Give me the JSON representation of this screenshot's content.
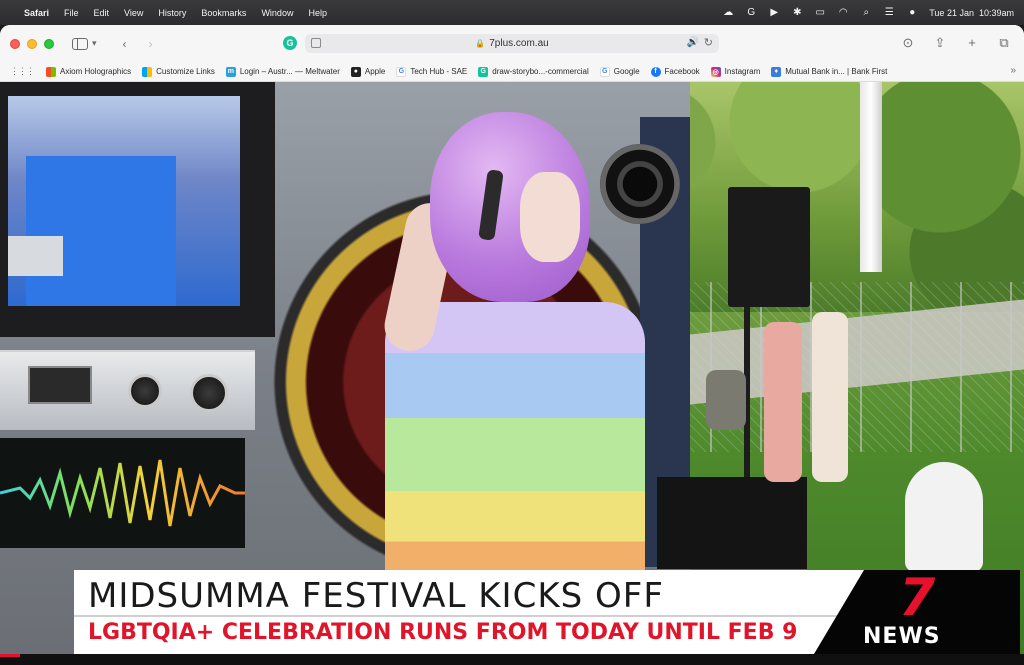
{
  "menubar": {
    "app_name": "Safari",
    "menus": [
      "File",
      "Edit",
      "View",
      "History",
      "Bookmarks",
      "Window",
      "Help"
    ],
    "date": "Tue 21 Jan",
    "time": "10:39am"
  },
  "browser": {
    "url": "7plus.com.au",
    "favorites": [
      {
        "label": "Axiom Holographics",
        "icon": "windows-grid-icon",
        "color": "#f25022"
      },
      {
        "label": "Customize Links",
        "icon": "windows-grid-icon",
        "color": "#00a4ef"
      },
      {
        "label": "Login – Austr... — Meltwater",
        "icon": "meltwater-icon",
        "color": "#2a9fd8"
      },
      {
        "label": "Apple",
        "icon": "apple-icon",
        "color": "#222222"
      },
      {
        "label": "Tech Hub - SAE",
        "icon": "google-icon",
        "color": "#4285f4"
      },
      {
        "label": "draw-storybo...-commercial",
        "icon": "grammarly-icon",
        "color": "#15c39a"
      },
      {
        "label": "Google",
        "icon": "google-icon",
        "color": "#4285f4"
      },
      {
        "label": "Facebook",
        "icon": "facebook-icon",
        "color": "#1877f2"
      },
      {
        "label": "Instagram",
        "icon": "instagram-icon",
        "color": "#d62976"
      },
      {
        "label": "Mutual Bank in... | Bank First",
        "icon": "bank-icon",
        "color": "#3b7ddd"
      }
    ]
  },
  "video": {
    "headline": "MIDSUMMA FESTIVAL KICKS OFF",
    "subheadline": "LGBTQIA+ CELEBRATION RUNS FROM TODAY UNTIL FEB 9",
    "brand_numeral": "7",
    "brand_word": "NEWS",
    "accent_color": "#e8112d",
    "progress": 0.02
  }
}
